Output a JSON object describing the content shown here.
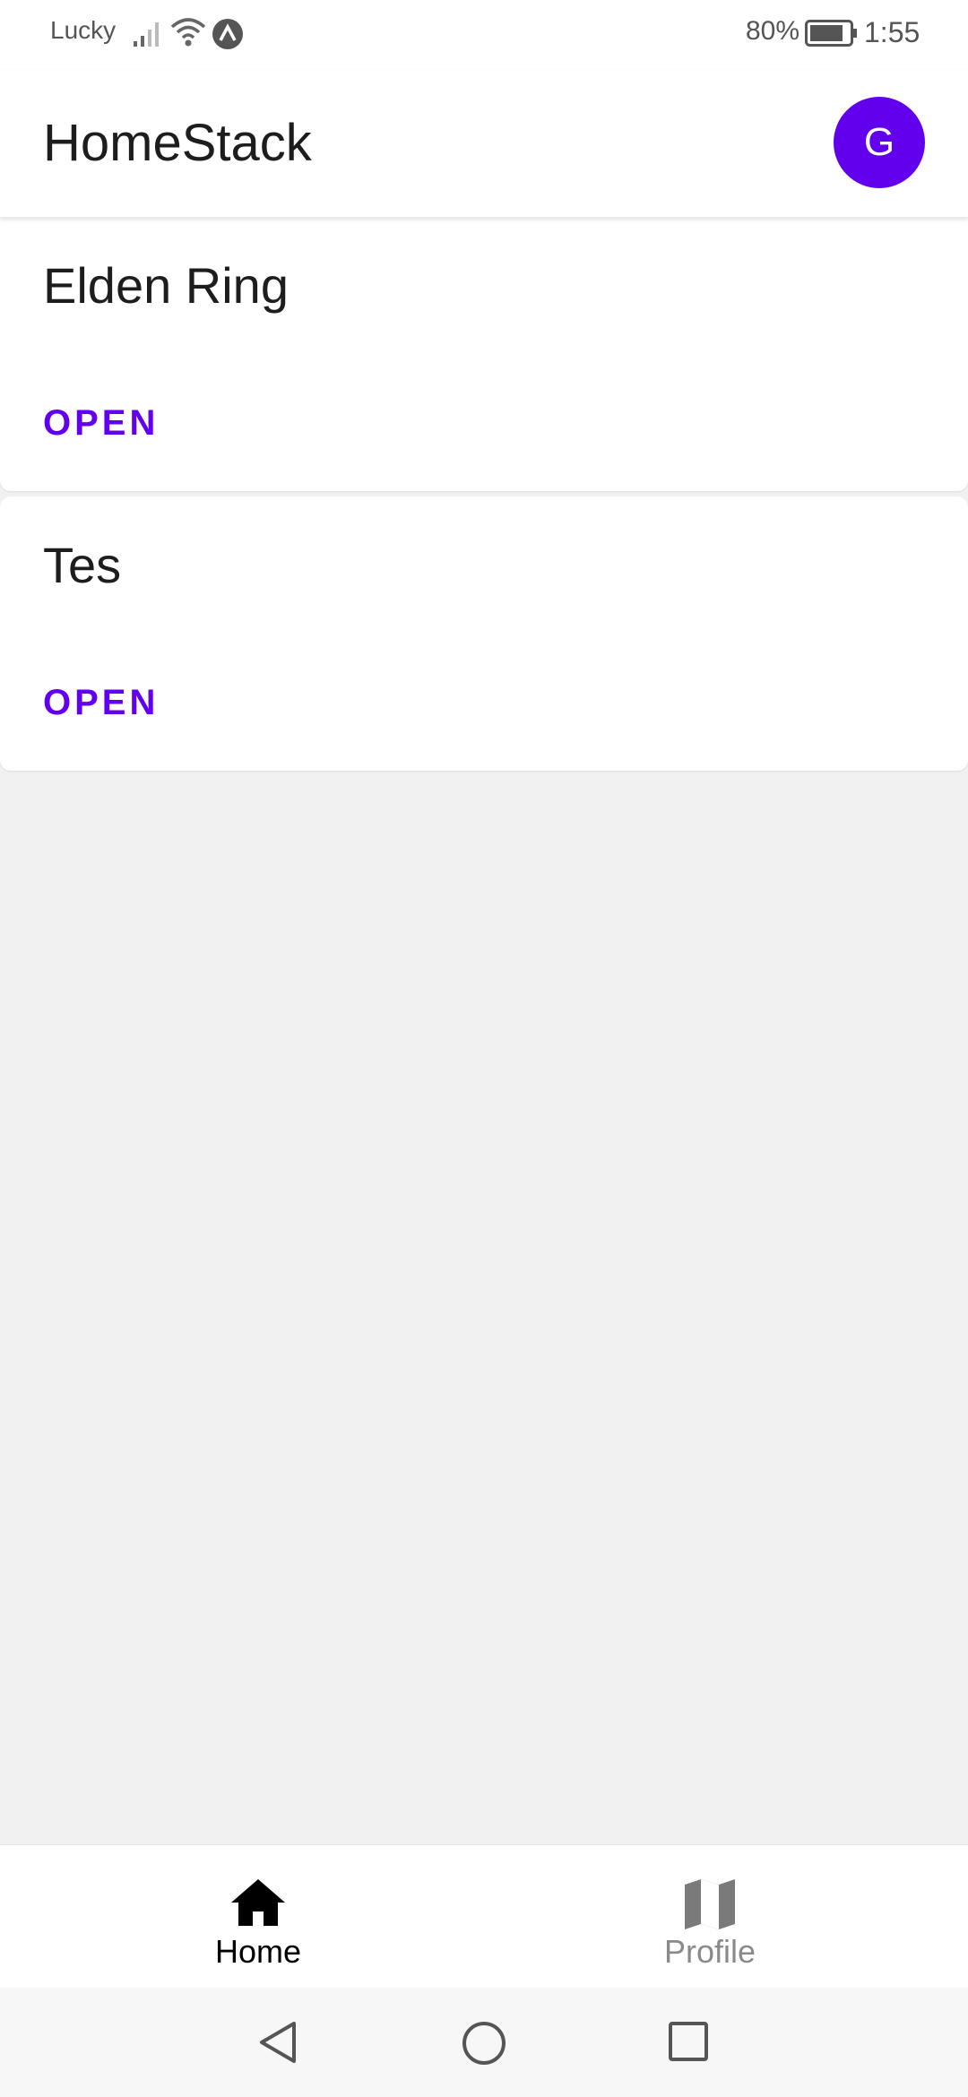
{
  "status_bar": {
    "carrier": "Lucky",
    "battery_percent": "80%",
    "battery_level": 0.8,
    "time": "1:55",
    "icons": [
      "signal-icon",
      "wifi-icon",
      "expo-icon",
      "battery-icon"
    ]
  },
  "app_bar": {
    "title": "HomeStack",
    "avatar_letter": "G"
  },
  "cards": [
    {
      "title": "Elden Ring",
      "action": "OPEN"
    },
    {
      "title": "Tes",
      "action": "OPEN"
    }
  ],
  "tabs": [
    {
      "label": "Home",
      "icon": "home-icon",
      "active": true
    },
    {
      "label": "Profile",
      "icon": "map-icon",
      "active": false
    }
  ],
  "nav_bar": {
    "buttons": [
      "back-icon",
      "home-circle-icon",
      "recents-icon"
    ]
  },
  "colors": {
    "accent": "#6200ee",
    "background": "#f1f1f1",
    "surface": "#ffffff",
    "text": "#1d1d1d",
    "inactive": "#8a8a8a"
  }
}
